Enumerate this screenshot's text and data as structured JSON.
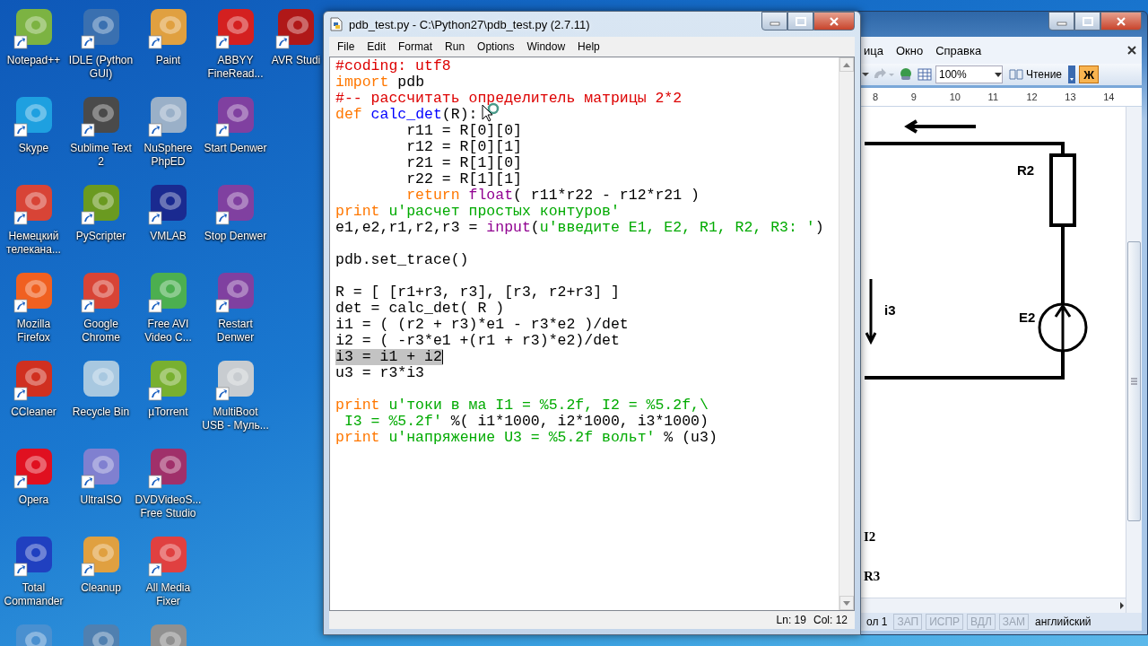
{
  "desktop_icons": [
    [
      {
        "label": "Notepad++",
        "color": "#7cb342",
        "shortcut": true
      },
      {
        "label": "IDLE (Python GUI)",
        "color": "#3a70b0",
        "shortcut": true
      },
      {
        "label": "Paint",
        "color": "#e0a040",
        "shortcut": true
      },
      {
        "label": "ABBYY FineRead...",
        "color": "#d42020",
        "shortcut": true
      },
      {
        "label": "AVR Studi",
        "color": "#b01818",
        "shortcut": true
      }
    ],
    [
      {
        "label": "Skype",
        "color": "#1ea0e0",
        "shortcut": true
      },
      {
        "label": "Sublime Text 2",
        "color": "#4a4a4a",
        "shortcut": true
      },
      {
        "label": "NuSphere PhpED",
        "color": "#9ab0c8",
        "shortcut": true
      },
      {
        "label": "Start Denwer",
        "color": "#8040a0",
        "shortcut": true
      }
    ],
    [
      {
        "label": "Немецкий телекана...",
        "color": "#d84436",
        "shortcut": true
      },
      {
        "label": "PyScripter",
        "color": "#6a9a20",
        "shortcut": true
      },
      {
        "label": "VMLAB",
        "color": "#1a2a90",
        "shortcut": true
      },
      {
        "label": "Stop Denwer",
        "color": "#8040a0",
        "shortcut": true
      }
    ],
    [
      {
        "label": "Mozilla Firefox",
        "color": "#f06020",
        "shortcut": true
      },
      {
        "label": "Google Chrome",
        "color": "#d84436",
        "shortcut": true
      },
      {
        "label": "Free AVI Video C...",
        "color": "#4caf50",
        "shortcut": true
      },
      {
        "label": "Restart Denwer",
        "color": "#8040a0",
        "shortcut": true
      }
    ],
    [
      {
        "label": "CCleaner",
        "color": "#d03020",
        "shortcut": true
      },
      {
        "label": "Recycle Bin",
        "color": "#a8c8e0",
        "shortcut": false
      },
      {
        "label": "µTorrent",
        "color": "#78b030",
        "shortcut": true
      },
      {
        "label": "MultiBoot USB - Муль...",
        "color": "#c8ccd0",
        "shortcut": true
      }
    ],
    [
      {
        "label": "Opera",
        "color": "#e01020",
        "shortcut": true
      },
      {
        "label": "UltraISO",
        "color": "#8080d0",
        "shortcut": true
      },
      {
        "label": "DVDVideoS... Free Studio",
        "color": "#a0306a",
        "shortcut": true
      }
    ],
    [
      {
        "label": "Total Commander",
        "color": "#2040c0",
        "shortcut": true
      },
      {
        "label": "Cleanup",
        "color": "#e0a040",
        "shortcut": true
      },
      {
        "label": "All Media Fixer",
        "color": "#e04040",
        "shortcut": true
      }
    ],
    [
      {
        "color": "#4a90d0"
      },
      {
        "color": "#5080b0"
      },
      {
        "color": "#909090"
      }
    ]
  ],
  "word": {
    "menu": [
      "ица",
      "Окно",
      "Справка"
    ],
    "zoom": "100%",
    "reading_button": "Чтение",
    "bold_button": "Ж",
    "bold_active": true,
    "ruler": [
      "8",
      "9",
      "10",
      "11",
      "12",
      "13",
      "14"
    ],
    "diagram_labels": [
      "R2",
      "i3",
      "E2",
      "I2",
      "R3"
    ],
    "status": [
      {
        "text": "ол 1",
        "disabled": false
      },
      {
        "text": "ЗАП",
        "disabled": true
      },
      {
        "text": "ИСПР",
        "disabled": true
      },
      {
        "text": "ВДЛ",
        "disabled": true
      },
      {
        "text": "ЗАМ",
        "disabled": true
      },
      {
        "text": "английский",
        "disabled": false
      }
    ]
  },
  "editor": {
    "title": "pdb_test.py - C:\\Python27\\pdb_test.py (2.7.11)",
    "menu": [
      "File",
      "Edit",
      "Format",
      "Run",
      "Options",
      "Window",
      "Help"
    ],
    "lines": [
      {
        "tokens": [
          {
            "text": "#coding: utf8",
            "kind": "comment"
          }
        ],
        "selected": false
      },
      {
        "tokens": [
          {
            "text": "import",
            "kind": "keyword"
          },
          {
            "text": " pdb",
            "kind": "plain"
          }
        ],
        "selected": false
      },
      {
        "tokens": [
          {
            "text": "#-- рассчитать определитель матрицы 2*2",
            "kind": "comment"
          }
        ],
        "selected": false
      },
      {
        "tokens": [
          {
            "text": "def",
            "kind": "keyword"
          },
          {
            "text": " calc_det",
            "kind": "definition"
          },
          {
            "text": "(R):",
            "kind": "plain"
          }
        ],
        "selected": false
      },
      {
        "tokens": [
          {
            "text": "        r11 = R[0][0]",
            "kind": "plain"
          }
        ],
        "selected": false
      },
      {
        "tokens": [
          {
            "text": "        r12 = R[0][1]",
            "kind": "plain"
          }
        ],
        "selected": false
      },
      {
        "tokens": [
          {
            "text": "        r21 = R[1][0]",
            "kind": "plain"
          }
        ],
        "selected": false
      },
      {
        "tokens": [
          {
            "text": "        r22 = R[1][1]",
            "kind": "plain"
          }
        ],
        "selected": false
      },
      {
        "tokens": [
          {
            "text": "        return",
            "kind": "keyword"
          },
          {
            "text": " float",
            "kind": "builtin"
          },
          {
            "text": "( r11*r22 - r12*r21 )",
            "kind": "plain"
          }
        ],
        "selected": false
      },
      {
        "tokens": [
          {
            "text": "print",
            "kind": "keyword"
          },
          {
            "text": " u'расчет простых контуров'",
            "kind": "string"
          }
        ],
        "selected": false
      },
      {
        "tokens": [
          {
            "text": "e1,e2,r1,r2,r3 = ",
            "kind": "plain"
          },
          {
            "text": "input",
            "kind": "builtin"
          },
          {
            "text": "(",
            "kind": "plain"
          },
          {
            "text": "u'введите E1, E2, R1, R2, R3: '",
            "kind": "string"
          },
          {
            "text": ")",
            "kind": "plain"
          }
        ],
        "selected": false
      },
      {
        "selected": false
      },
      {
        "tokens": [
          {
            "text": "pdb.set_trace()",
            "kind": "plain"
          }
        ],
        "selected": false
      },
      {
        "selected": false
      },
      {
        "tokens": [
          {
            "text": "R = [ [r1+r3, r3], [r3, r2+r3] ]",
            "kind": "plain"
          }
        ],
        "selected": false
      },
      {
        "tokens": [
          {
            "text": "det = calc_det( R )",
            "kind": "plain"
          }
        ],
        "selected": false
      },
      {
        "tokens": [
          {
            "text": "i1 = ( (r2 + r3)*e1 - r3*e2 )/det",
            "kind": "plain"
          }
        ],
        "selected": false
      },
      {
        "tokens": [
          {
            "text": "i2 = ( -r3*e1 +(r1 + r3)*e2)/det",
            "kind": "plain"
          }
        ],
        "selected": false
      },
      {
        "tokens": [
          {
            "text": "i3 = i1 + i2",
            "kind": "plain"
          }
        ],
        "selected": true
      },
      {
        "tokens": [
          {
            "text": "u3 = r3*i3",
            "kind": "plain"
          }
        ],
        "selected": false
      },
      {
        "selected": false
      },
      {
        "tokens": [
          {
            "text": "print",
            "kind": "keyword"
          },
          {
            "text": " u'токи в ма I1 = %5.2f, I2 = %5.2f,\\",
            "kind": "string"
          }
        ],
        "selected": false
      },
      {
        "tokens": [
          {
            "text": " I3 = %5.2f'",
            "kind": "string"
          },
          {
            "text": " %( i1*1000, i2*1000, i3*1000)",
            "kind": "plain"
          }
        ],
        "selected": false
      },
      {
        "tokens": [
          {
            "text": "print",
            "kind": "keyword"
          },
          {
            "text": " u'напряжение U3 = %5.2f вольт'",
            "kind": "string"
          },
          {
            "text": " % (u3)",
            "kind": "plain"
          }
        ],
        "selected": false
      }
    ],
    "status": {
      "line": "Ln: 19",
      "col": "Col: 12"
    }
  }
}
